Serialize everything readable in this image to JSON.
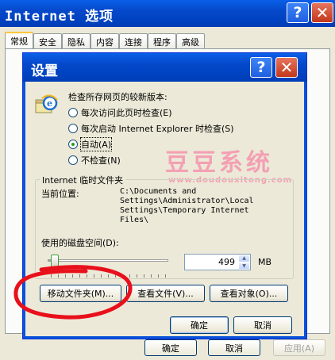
{
  "background_window": {
    "title": "Internet 选项",
    "tabs": [
      "常规",
      "安全",
      "隐私",
      "内容",
      "连接",
      "程序",
      "高级"
    ],
    "buttons": {
      "ok": "确定",
      "cancel": "取消",
      "apply": "应用(A)"
    }
  },
  "dialog": {
    "title": "设置",
    "heading": "检查所存网页的较新版本:",
    "radios": [
      {
        "label": "每次访问此页时检查(E)",
        "selected": false
      },
      {
        "label": "每次启动 Internet Explorer 时检查(S)",
        "selected": false
      },
      {
        "label": "自动(A)",
        "selected": true
      },
      {
        "label": "不检查(N)",
        "selected": false
      }
    ],
    "temp_group": {
      "title": "Internet 临时文件夹",
      "location_label": "当前位置:",
      "location_value": "C:\\Documents and\nSettings\\Administrator\\Local\nSettings\\Temporary Internet\nFiles\\",
      "disk_space_label": "使用的磁盘空间(D):",
      "disk_space_value": "499",
      "unit": "MB",
      "slider_fraction": 0.03
    },
    "buttons": {
      "move_folder": "移动文件夹(M)...",
      "view_files": "查看文件(V)...",
      "view_objects": "查看对象(O)...",
      "ok": "确定",
      "cancel": "取消"
    }
  },
  "watermark": {
    "text": "豆豆系统",
    "url": "www.doudouxitong.com"
  },
  "colors": {
    "title_blue": "#0548c9",
    "annotation_red": "#e8101b",
    "watermark_pink": "#f4a0b4"
  }
}
